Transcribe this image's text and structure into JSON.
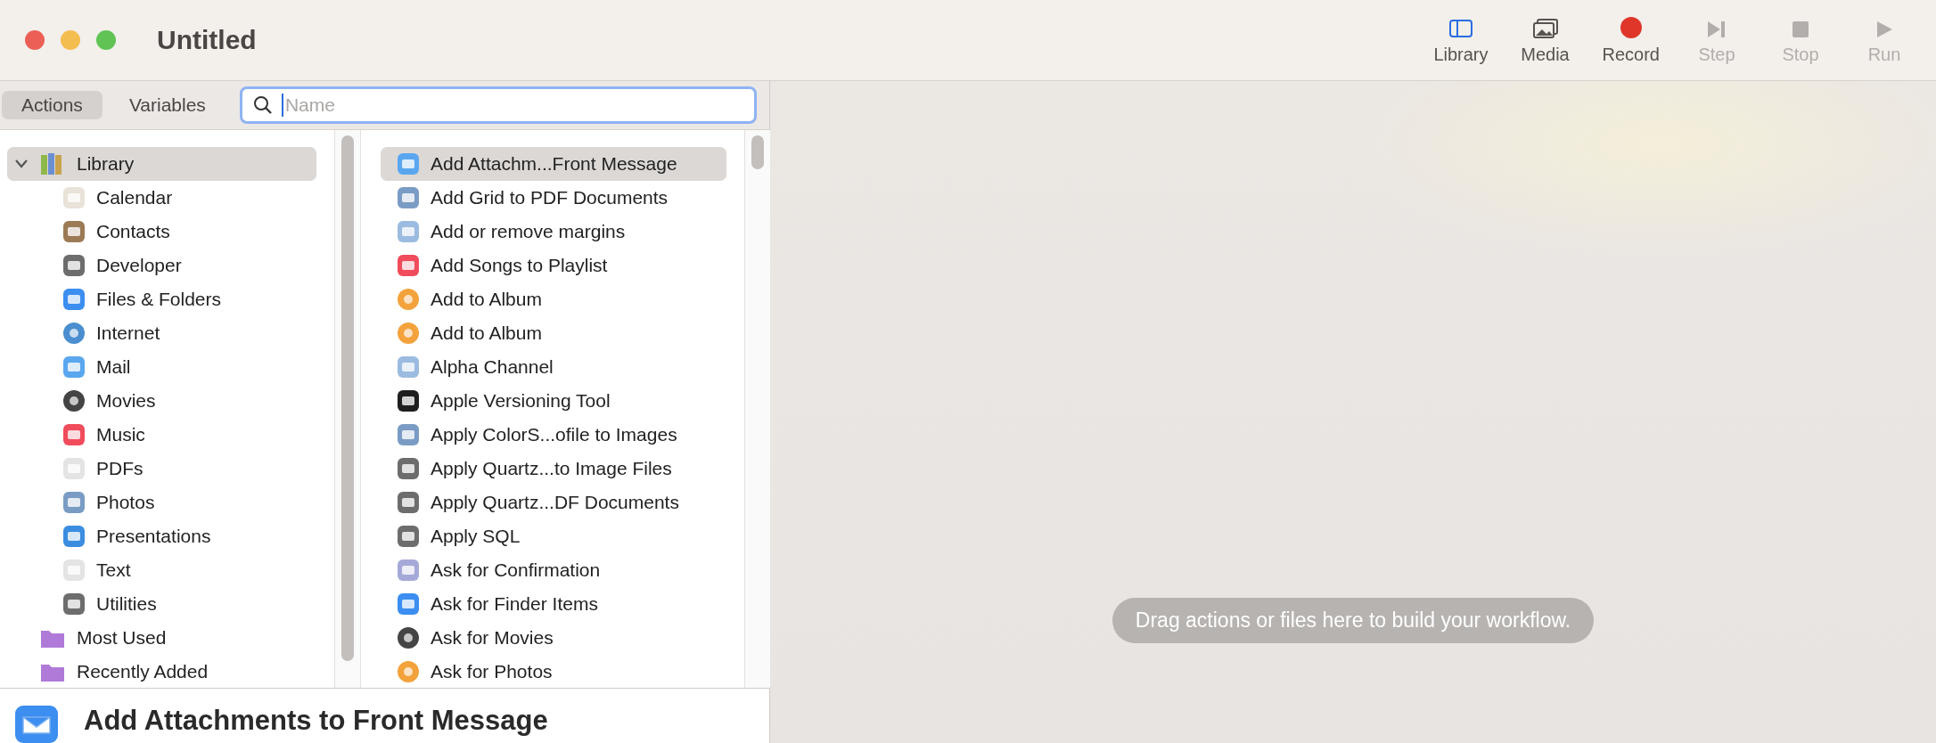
{
  "window": {
    "title": "Untitled"
  },
  "toolbar": [
    {
      "label": "Library",
      "kind": "library",
      "disabled": false
    },
    {
      "label": "Media",
      "kind": "media",
      "disabled": false
    },
    {
      "label": "Record",
      "kind": "record",
      "disabled": false
    },
    {
      "label": "Step",
      "kind": "step",
      "disabled": true
    },
    {
      "label": "Stop",
      "kind": "stop",
      "disabled": true
    },
    {
      "label": "Run",
      "kind": "run",
      "disabled": true
    }
  ],
  "tabs": [
    {
      "label": "Actions",
      "selected": true
    },
    {
      "label": "Variables",
      "selected": false
    }
  ],
  "search": {
    "placeholder": "Name"
  },
  "library": [
    {
      "label": "Library",
      "expanded": true,
      "selected": true,
      "children": [
        {
          "label": "Calendar"
        },
        {
          "label": "Contacts"
        },
        {
          "label": "Developer"
        },
        {
          "label": "Files & Folders"
        },
        {
          "label": "Internet"
        },
        {
          "label": "Mail"
        },
        {
          "label": "Movies"
        },
        {
          "label": "Music"
        },
        {
          "label": "PDFs"
        },
        {
          "label": "Photos"
        },
        {
          "label": "Presentations"
        },
        {
          "label": "Text"
        },
        {
          "label": "Utilities"
        }
      ]
    },
    {
      "label": "Most Used",
      "selected": false
    },
    {
      "label": "Recently Added",
      "selected": false
    }
  ],
  "actions": [
    {
      "label": "Add Attachm...Front Message",
      "selected": true
    },
    {
      "label": "Add Grid to PDF Documents",
      "selected": false
    },
    {
      "label": "Add or remove margins",
      "selected": false
    },
    {
      "label": "Add Songs to Playlist",
      "selected": false
    },
    {
      "label": "Add to Album",
      "selected": false
    },
    {
      "label": "Add to Album",
      "selected": false
    },
    {
      "label": "Alpha Channel",
      "selected": false
    },
    {
      "label": "Apple Versioning Tool",
      "selected": false
    },
    {
      "label": "Apply ColorS...ofile to Images",
      "selected": false
    },
    {
      "label": "Apply Quartz...to Image Files",
      "selected": false
    },
    {
      "label": "Apply Quartz...DF Documents",
      "selected": false
    },
    {
      "label": "Apply SQL",
      "selected": false
    },
    {
      "label": "Ask for Confirmation",
      "selected": false
    },
    {
      "label": "Ask for Finder Items",
      "selected": false
    },
    {
      "label": "Ask for Movies",
      "selected": false
    },
    {
      "label": "Ask for Photos",
      "selected": false
    }
  ],
  "detail": {
    "title": "Add Attachments to Front Message"
  },
  "canvas": {
    "hint": "Drag actions or files here to build your workflow."
  }
}
